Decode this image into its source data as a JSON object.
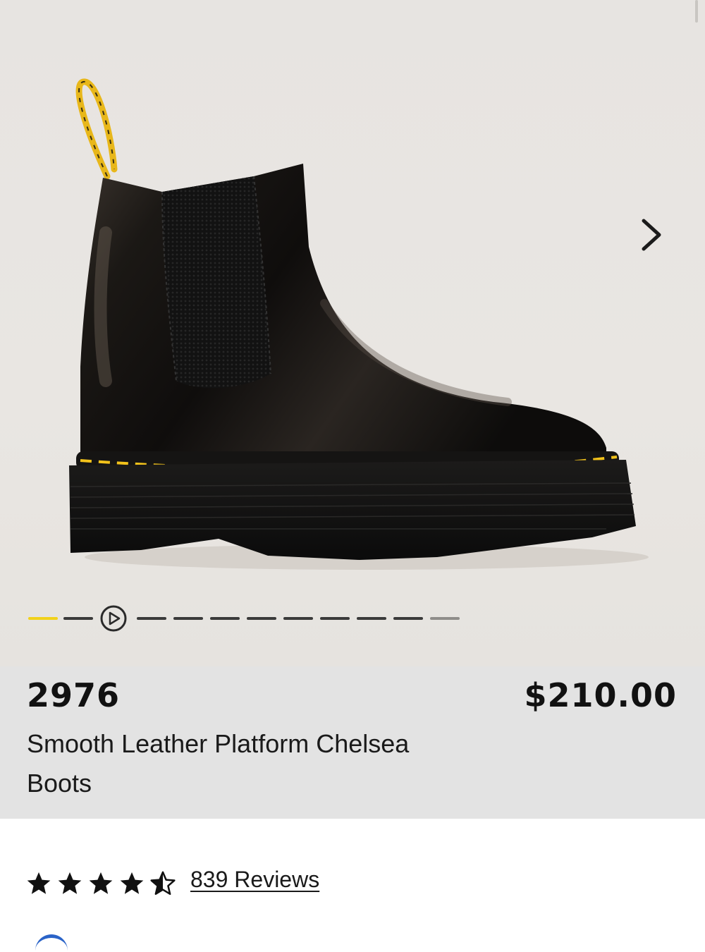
{
  "gallery": {
    "image_alt": "2976 Smooth Leather Platform Chelsea Boots",
    "next_icon": "chevron-right-icon",
    "video_icon": "play-icon",
    "active_index": 0,
    "indicator_count": 12,
    "colors": {
      "active": "#f2d21b",
      "inactive": "#3a3a3a"
    }
  },
  "product": {
    "model_number": "2976",
    "price": "$210.00",
    "name": "Smooth Leather Platform Chelsea Boots"
  },
  "reviews": {
    "rating": 4.5,
    "max_rating": 5,
    "link_label": "839 Reviews"
  }
}
